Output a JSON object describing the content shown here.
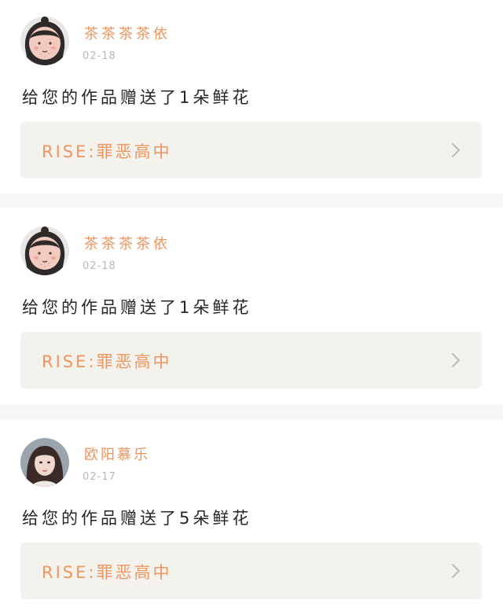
{
  "notifications": [
    {
      "username": "茶茶茶茶依",
      "date": "02-18",
      "avatar": "avatar-cartoon-face-icon",
      "message": "给您的作品赠送了1朵鲜花",
      "work_title": "RISE:罪恶高中"
    },
    {
      "username": "茶茶茶茶依",
      "date": "02-18",
      "avatar": "avatar-cartoon-face-icon",
      "message": "给您的作品赠送了1朵鲜花",
      "work_title": "RISE:罪恶高中"
    },
    {
      "username": "欧阳慕乐",
      "date": "02-17",
      "avatar": "avatar-photo-icon",
      "message": "给您的作品赠送了5朵鲜花",
      "work_title": "RISE:罪恶高中"
    }
  ],
  "colors": {
    "accent": "#ee9560",
    "date": "#b9b9b9",
    "text": "#262626",
    "link_bg": "#f3f2ec",
    "divider": "#f6f6f6",
    "chevron": "#bdbdbd"
  }
}
